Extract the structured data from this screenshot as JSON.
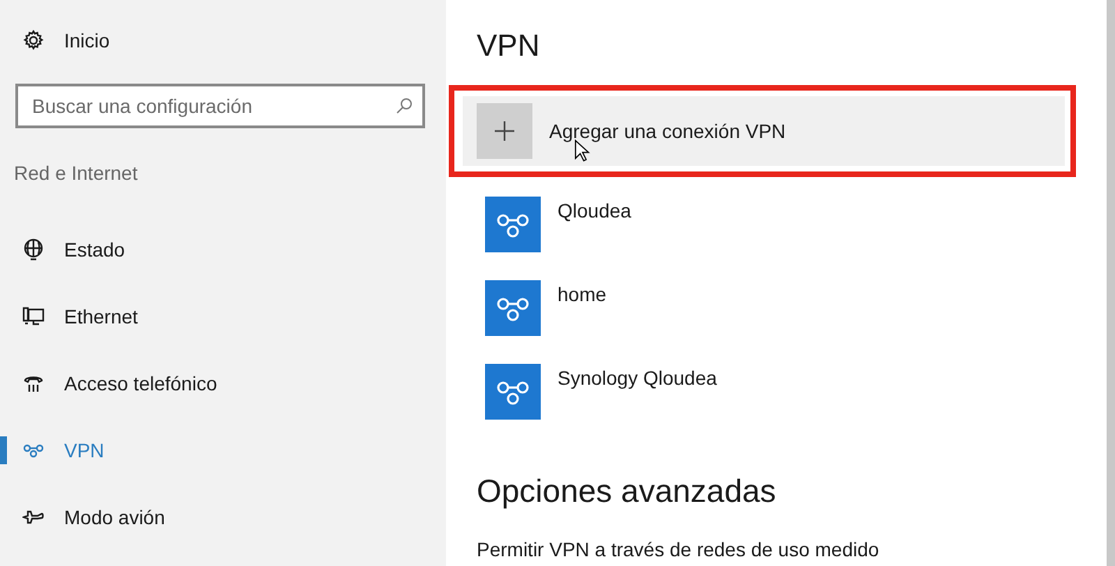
{
  "sidebar": {
    "home": {
      "label": "Inicio"
    },
    "search": {
      "placeholder": "Buscar una configuración"
    },
    "section_title": "Red e Internet",
    "items": [
      {
        "label": "Estado",
        "selected": false
      },
      {
        "label": "Ethernet",
        "selected": false
      },
      {
        "label": "Acceso telefónico",
        "selected": false
      },
      {
        "label": "VPN",
        "selected": true
      },
      {
        "label": "Modo avión",
        "selected": false
      }
    ]
  },
  "main": {
    "title": "VPN",
    "add_connection": {
      "label": "Agregar una conexión VPN",
      "highlighted": true
    },
    "connections": [
      {
        "name": "Qloudea"
      },
      {
        "name": "home"
      },
      {
        "name": "Synology Qloudea"
      }
    ],
    "advanced_title": "Opciones avanzadas",
    "advanced_text": "Permitir VPN a través de redes de uso medido"
  }
}
